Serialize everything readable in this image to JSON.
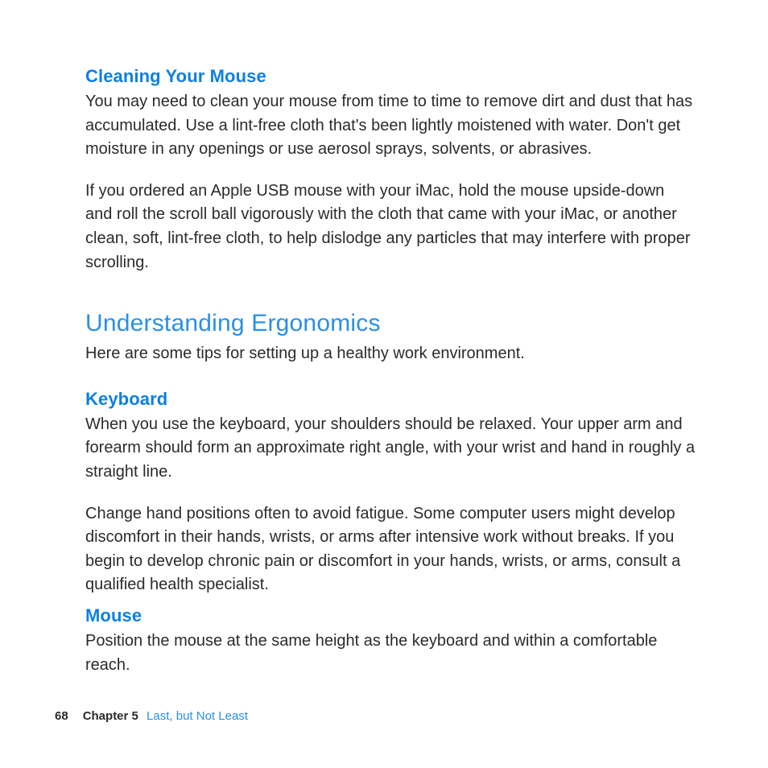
{
  "sections": {
    "cleaning_mouse": {
      "heading": "Cleaning Your Mouse",
      "p1": "You may need to clean your mouse from time to time to remove dirt and dust that has accumulated. Use a lint-free cloth that's been lightly moistened with water. Don't get moisture in any openings or use aerosol sprays, solvents, or abrasives.",
      "p2": "If you ordered an Apple USB mouse with your iMac, hold the mouse upside-down and roll the scroll ball vigorously with the cloth that came with your iMac, or another clean, soft, lint-free cloth, to help dislodge any particles that may interfere with proper scrolling."
    },
    "ergonomics": {
      "heading": "Understanding Ergonomics",
      "intro": "Here are some tips for setting up a healthy work environment."
    },
    "keyboard": {
      "heading": "Keyboard",
      "p1": "When you use the keyboard, your shoulders should be relaxed. Your upper arm and forearm should form an approximate right angle, with your wrist and hand in roughly a straight line.",
      "p2": "Change hand positions often to avoid fatigue. Some computer users might develop discomfort in their hands, wrists, or arms after intensive work without breaks. If you begin to develop chronic pain or discomfort in your hands, wrists, or arms, consult a qualified health specialist."
    },
    "mouse": {
      "heading": "Mouse",
      "p1": "Position the mouse at the same height as the keyboard and within a comfortable reach."
    }
  },
  "footer": {
    "page_number": "68",
    "chapter_label": "Chapter 5",
    "chapter_title": "Last, but Not Least"
  }
}
